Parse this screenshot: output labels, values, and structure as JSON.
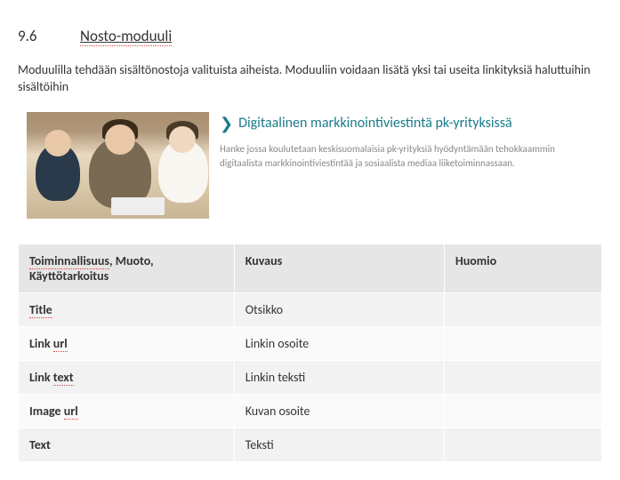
{
  "heading": {
    "number": "9.6",
    "title": "Nosto-moduuli"
  },
  "intro": "Moduulilla tehdään sisältönostoja valituista aiheista. Moduuliin voidaan lisätä yksi tai useita linkityksiä haluttuihin sisältöihin",
  "example": {
    "link_text": "Digitaalinen markkinointiviestintä pk-yrityksissä",
    "description": "Hanke jossa koulutetaan keskisuomalaisia pk-yrityksiä hyödyntämään tehokkaammin digitaalista markkinointiviestintää ja sosiaalista mediaa liiketoiminnassaan."
  },
  "table": {
    "headers": {
      "col1_part1": "Toiminnallisuus",
      "col1_part2": ", Muoto, Käyttötarkoitus",
      "col2": "Kuvaus",
      "col3": "Huomio"
    },
    "rows": [
      {
        "field_a": "Title",
        "field_b": "",
        "desc": "Otsikko",
        "note": ""
      },
      {
        "field_a": "Link ",
        "field_b": "url",
        "desc": "Linkin osoite",
        "note": ""
      },
      {
        "field_a": "Link ",
        "field_b": "text",
        "desc": "Linkin teksti",
        "note": ""
      },
      {
        "field_a": "Image ",
        "field_b": "url",
        "desc": "Kuvan osoite",
        "note": ""
      },
      {
        "field_a": "Text",
        "field_b": "",
        "desc": "Teksti",
        "note": ""
      }
    ]
  }
}
